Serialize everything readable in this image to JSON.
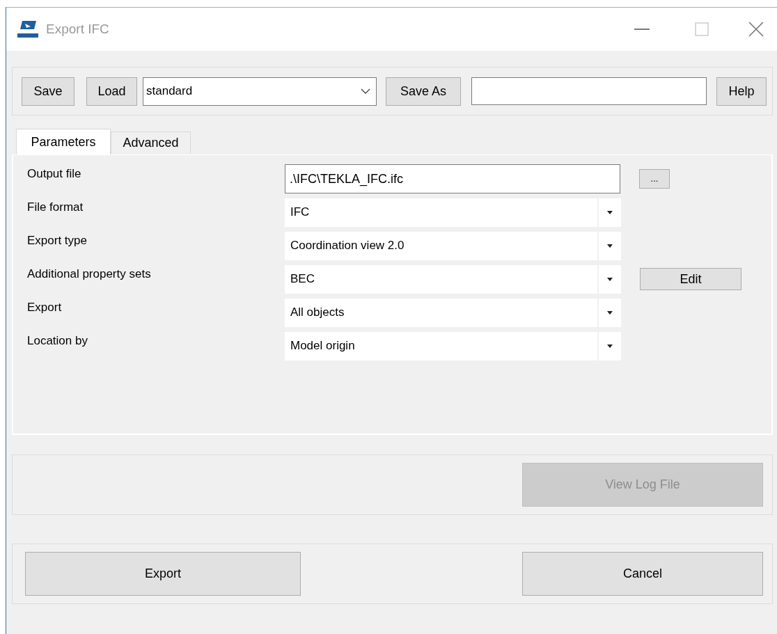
{
  "window": {
    "title": "Export IFC"
  },
  "toolbar": {
    "save": "Save",
    "load": "Load",
    "preset": "standard",
    "save_as": "Save As",
    "help": "Help"
  },
  "tabs": [
    {
      "label": "Parameters",
      "selected": true
    },
    {
      "label": "Advanced",
      "selected": false
    }
  ],
  "parameters": [
    {
      "label": "Output file",
      "kind": "text",
      "value": ".\\IFC\\TEKLA_IFC.ifc",
      "button": "..."
    },
    {
      "label": "File format",
      "kind": "combo",
      "value": "IFC"
    },
    {
      "label": "Export type",
      "kind": "combo",
      "value": "Coordination view 2.0"
    },
    {
      "label": "Additional property sets",
      "kind": "combo",
      "value": "BEC",
      "button": "Edit"
    },
    {
      "label": "Export",
      "kind": "combo",
      "value": "All objects"
    },
    {
      "label": "Location by",
      "kind": "combo",
      "value": "Model origin"
    }
  ],
  "log_button": {
    "label": "View Log File",
    "disabled": true
  },
  "actions": {
    "export": "Export",
    "cancel": "Cancel"
  }
}
